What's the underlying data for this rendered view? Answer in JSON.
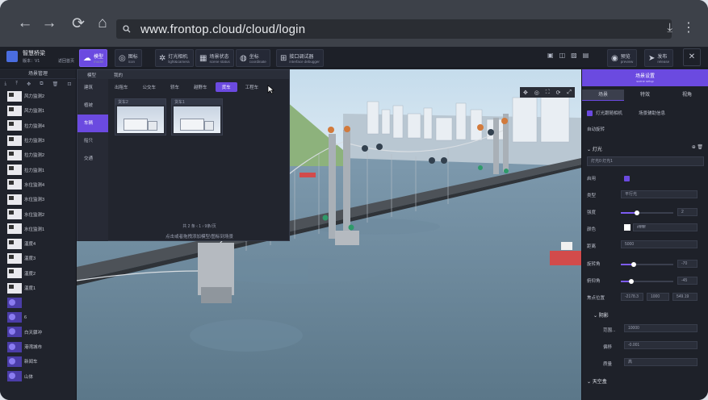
{
  "browser": {
    "url": "www.frontop.cloud/cloud/login",
    "back": "←",
    "forward": "→",
    "reload": "⟳",
    "home": "⌂",
    "download": "⤓",
    "menu": "⋮"
  },
  "app": {
    "title": "智慧桥梁",
    "version": "版本：V1",
    "home_label": "返回首页"
  },
  "toolbar": [
    {
      "label": "模型",
      "sub": "model",
      "icon": "☁",
      "active": true
    },
    {
      "label": "图标",
      "sub": "icon",
      "icon": "◎",
      "active": false
    },
    {
      "label": "灯光相机",
      "sub": "light&camera",
      "icon": "✲",
      "active": false
    },
    {
      "label": "场景状态",
      "sub": "scene status",
      "icon": "▦",
      "active": false
    },
    {
      "label": "坐标",
      "sub": "coordinate",
      "icon": "◍",
      "active": false
    },
    {
      "label": "接口调试器",
      "sub": "interface debugger",
      "icon": "⊞",
      "active": false
    }
  ],
  "toolbar_right": [
    {
      "label": "预览",
      "sub": "preview",
      "icon": "◉"
    },
    {
      "label": "发布",
      "sub": "release",
      "icon": "➤"
    }
  ],
  "close": "✕",
  "scene_manager": {
    "title": "场景管理",
    "items": [
      {
        "label": "风力监测2",
        "purple": false
      },
      {
        "label": "风力监测1",
        "purple": false
      },
      {
        "label": "拉力监测4",
        "purple": false
      },
      {
        "label": "拉力监测3",
        "purple": false
      },
      {
        "label": "拉力监测2",
        "purple": false
      },
      {
        "label": "拉力监测1",
        "purple": false
      },
      {
        "label": "水位监测4",
        "purple": false
      },
      {
        "label": "水位监测3",
        "purple": false
      },
      {
        "label": "水位监测2",
        "purple": false
      },
      {
        "label": "水位监测1",
        "purple": false
      },
      {
        "label": "温度4",
        "purple": false
      },
      {
        "label": "温度3",
        "purple": false
      },
      {
        "label": "温度2",
        "purple": false
      },
      {
        "label": "温度1",
        "purple": false
      },
      {
        "label": "",
        "purple": true
      },
      {
        "label": "6",
        "purple": true
      },
      {
        "label": "白天骤冲",
        "purple": true
      },
      {
        "label": "港湾城市",
        "purple": true
      },
      {
        "label": "新闻车",
        "purple": true
      },
      {
        "label": "山体",
        "purple": true
      }
    ]
  },
  "model_panel": {
    "tabs": [
      "模型",
      "我的"
    ],
    "categories": [
      "建筑",
      "植被",
      "车辆",
      "船只",
      "交通"
    ],
    "active_category": "车辆",
    "subtabs": [
      "出租车",
      "公交车",
      "轿车",
      "越野车",
      "货车",
      "工程车"
    ],
    "active_subtab": "货车",
    "cards": [
      "货车2",
      "货车1"
    ],
    "pager": "共 2 条    ‹   1   ›     9条/页",
    "hint": "点击或者拖拽添加模型/图标到场景"
  },
  "view_tools": [
    "✥",
    "◎",
    "⛶",
    "⟳",
    "⤢"
  ],
  "settings": {
    "title": "场景设置",
    "sub": "scene setup",
    "tabs": [
      "场景",
      "特效",
      "视角"
    ],
    "active_tab": "场景",
    "lighting_follow": "灯光跟随相机",
    "scene_info": "场景辅助信息",
    "auto_rotate": "自动旋转",
    "light_section": "灯光",
    "light_tabs": "灯光0   灯光1",
    "enable": "启用",
    "type_label": "类型",
    "type_value": "平行光",
    "intensity_label": "强度",
    "intensity_value": "2",
    "intensity_pct": 30,
    "color_label": "颜色",
    "color_value": "#ffffff",
    "distance_label": "距离",
    "distance_value": "5000",
    "rotate_label": "旋转角",
    "rotate_value": "-70",
    "rotate_pct": 25,
    "pitch_label": "俯仰角",
    "pitch_value": "-45",
    "pitch_pct": 20,
    "focus_label": "焦点位置",
    "focus_x": "-2178.3",
    "focus_y": "1000",
    "focus_z": "549.19",
    "shadow_section": "阴影",
    "range_label": "范围...",
    "range_value": "10000",
    "bias_label": "偏移",
    "bias_value": "-0.001",
    "quality_label": "质量",
    "quality_value": "高",
    "sky_section": "天空盒"
  }
}
